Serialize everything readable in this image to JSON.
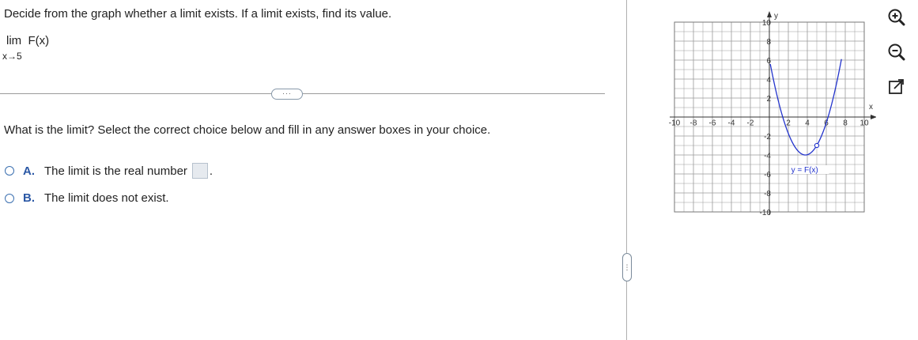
{
  "problem": {
    "prompt": "Decide from the graph whether a limit exists. If a limit exists, find its value.",
    "limit_word": "lim",
    "function": "F(x)",
    "approach": "x→5"
  },
  "more_button": "···",
  "question": "What is the limit? Select the correct choice below and fill in any answer boxes in your choice.",
  "choices": [
    {
      "letter": "A.",
      "text": "The limit is the real number",
      "has_box": true,
      "suffix": "."
    },
    {
      "letter": "B.",
      "text": "The limit does not exist."
    }
  ],
  "splitter": "⋮",
  "graph": {
    "x_label": "x",
    "y_label": "y",
    "curve_label": "y = F(x)",
    "xlim": [
      -10,
      10
    ],
    "ylim": [
      -10,
      10
    ],
    "x_ticks": [
      "-10",
      "-8",
      "-6",
      "-4",
      "-2",
      "2",
      "4",
      "6",
      "8",
      "10"
    ],
    "y_ticks": [
      "10",
      "8",
      "6",
      "4",
      "2",
      "-2",
      "-4",
      "-6",
      "-8",
      "-10"
    ],
    "curve_color": "#2233cc",
    "open_point": [
      5,
      -3
    ]
  },
  "tools": [
    "zoom-in-icon",
    "zoom-out-icon",
    "popout-icon"
  ]
}
